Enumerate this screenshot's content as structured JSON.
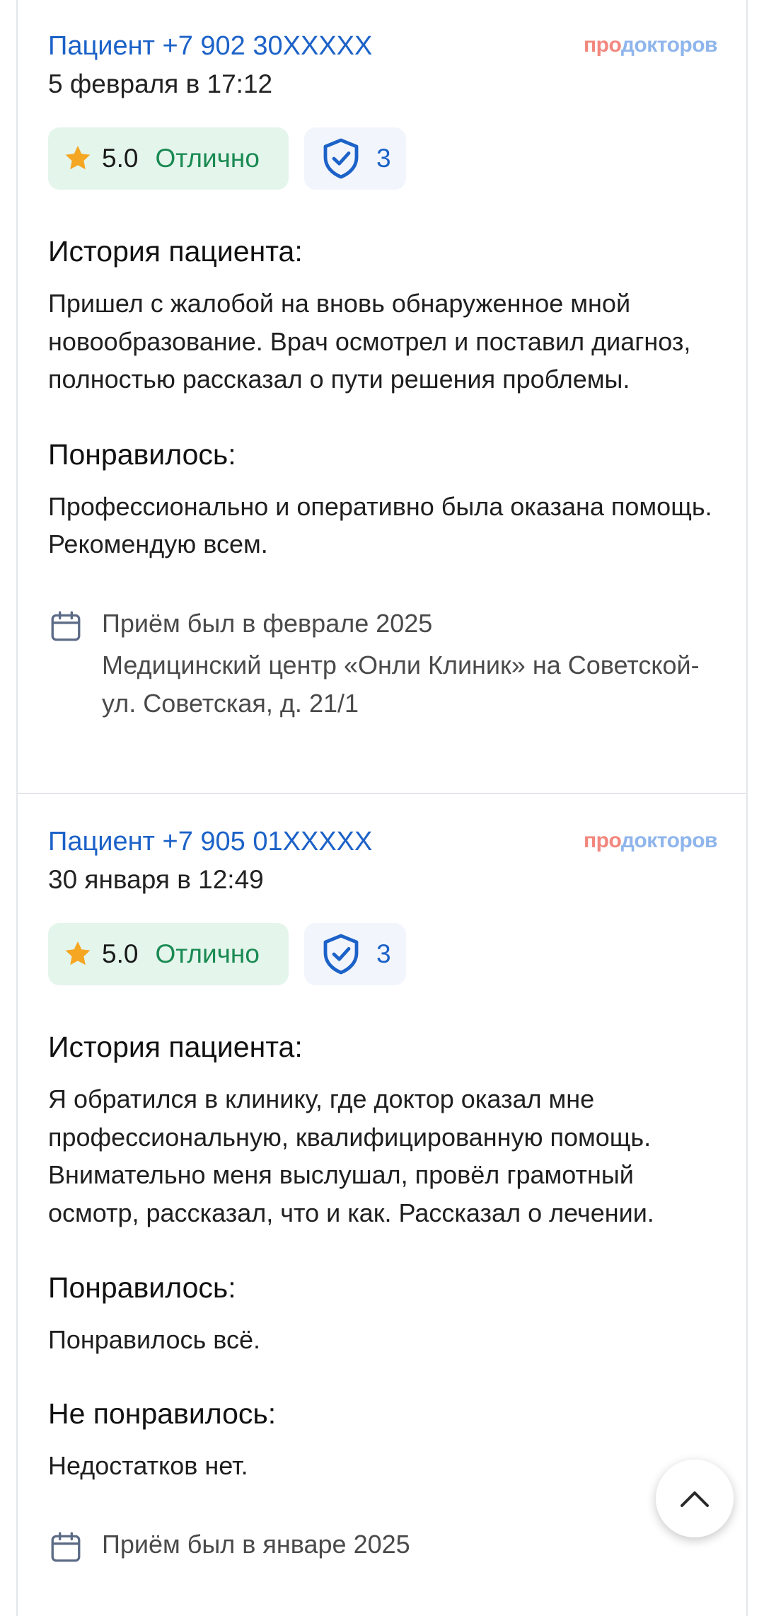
{
  "brand": {
    "part1": "про",
    "part2": "докторов"
  },
  "reviews": [
    {
      "author": "Пациент +7 902 30XXXXX",
      "date": "5 февраля в 17:12",
      "score": "5.0",
      "grade": "Отлично",
      "verified_count": "3",
      "history_title": "История пациента:",
      "history_text": "Пришел с жалобой на вновь обнаруженное мной новообразование. Врач осмотрел и поставил диагноз, полностью рассказал о пути решения проблемы.",
      "liked_title": "Понравилось:",
      "liked_text": "Профессионально и оперативно была оказана помощь. Рекомендую всем.",
      "visit_date": "Приём был в феврале 2025",
      "visit_place": "Медицинский центр «Онли Клиник» на Советской-ул. Советская, д. 21/1"
    },
    {
      "author": "Пациент +7 905 01XXXXX",
      "date": "30 января в 12:49",
      "score": "5.0",
      "grade": "Отлично",
      "verified_count": "3",
      "history_title": "История пациента:",
      "history_text": "Я обратился в клинику, где доктор оказал мне профессиональную, квалифицированную помощь. Внимательно меня выслушал, провёл грамотный осмотр, рассказал, что и как. Рассказал о лечении.",
      "liked_title": "Понравилось:",
      "liked_text": "Понравилось всё.",
      "disliked_title": "Не понравилось:",
      "disliked_text": "Недостатков нет.",
      "visit_date": "Приём был в январе 2025"
    }
  ],
  "icons": {
    "star": "star-icon",
    "shield": "shield-check-icon",
    "calendar": "calendar-icon",
    "scroll_top": "chevron-up-icon"
  },
  "colors": {
    "link": "#1c62c8",
    "rating_bg": "#e4f5ec",
    "rating_text": "#1a8a52",
    "star": "#f5a623",
    "verified_bg": "#f2f6fc"
  }
}
